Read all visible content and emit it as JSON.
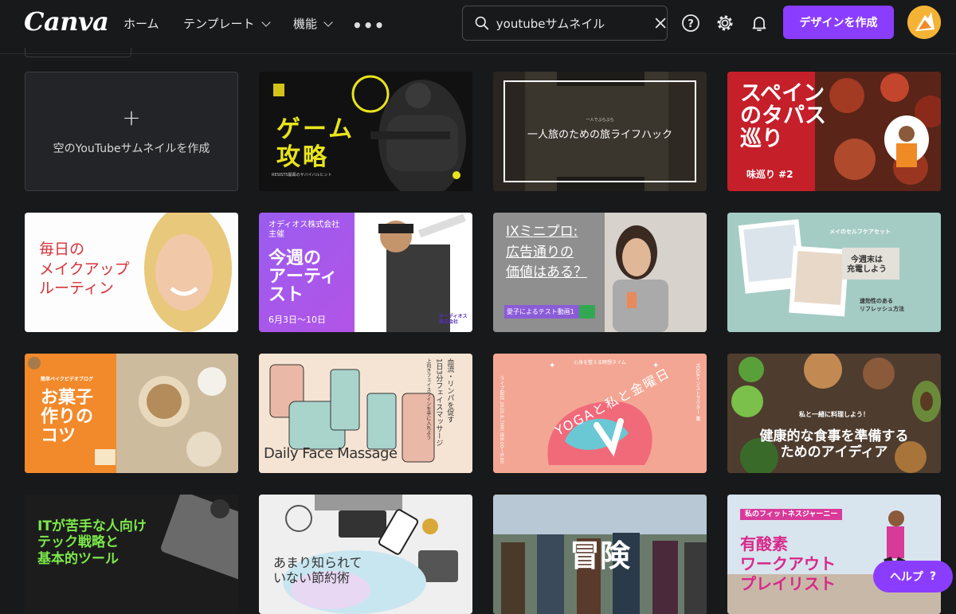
{
  "header": {
    "logo": "Canva",
    "nav": [
      {
        "label": "ホーム"
      },
      {
        "label": "テンプレート"
      },
      {
        "label": "機能"
      }
    ],
    "search_value": "youtubeサムネイル",
    "create_label": "デザインを作成"
  },
  "blank_card": {
    "label": "空のYouTubeサムネイルを作成"
  },
  "templates": {
    "game": {
      "title": "ゲーム\n攻略",
      "caption": "RESISTS開幕のサバイバルヒント"
    },
    "travel": {
      "small": "一人でぶらぶら",
      "title": "一人旅のための旅ライフハック"
    },
    "spain": {
      "title": "スペイン\nのタパス\n巡り",
      "sub": "味巡り #2"
    },
    "makeup": {
      "title": "毎日の\nメイクアップ\nルーティン"
    },
    "artist": {
      "org": "オディオス株式会社\n主催",
      "title": "今週の\nアーティ\nスト",
      "date": "6月3日〜10日",
      "tag": "オーディオス\n株式会社"
    },
    "minipro": {
      "title": "IXミニプロ:\n広告通りの\n価値はある？",
      "tag": "愛子によるテスト動画1"
    },
    "selfcare": {
      "small": "メイのセルフケアセット",
      "note": "今週末は\n充電しよう",
      "sub": "速効性のある\nリフレッシュ方法"
    },
    "sweets": {
      "small": "簡単ベイクビデオブログ",
      "title": "お菓子\n作りの\nコツ"
    },
    "massage": {
      "title": "Daily Face Massage",
      "vertical1": "血流・リンパを促す",
      "vertical2": "1日3分フェイスマッサージ",
      "vertical3": "上向きフェイスラインを手に入れよう"
    },
    "yoga": {
      "top": "心身を整える瞑想タイム",
      "title": "YOGAと私と金曜日",
      "left": "ライブ配信 2020.8.7(金) 夜8:00〜9:00",
      "right": "YOGAインストラクター 薫"
    },
    "food": {
      "small": "私と一緒に料理しよう！",
      "title": "健康的な食事を準備する\nためのアイディア"
    },
    "it": {
      "title": "ITが苦手な人向け\nテック戦略と\n基本的ツール"
    },
    "saving": {
      "title": "あまり知られて\nいない節約術"
    },
    "adventure": {
      "title": "冒険"
    },
    "fitness": {
      "small": "私のフィットネスジャーニー",
      "title": "有酸素\nワークアウト\nプレイリスト"
    }
  },
  "help": {
    "label": "ヘルプ",
    "icon": "?"
  }
}
